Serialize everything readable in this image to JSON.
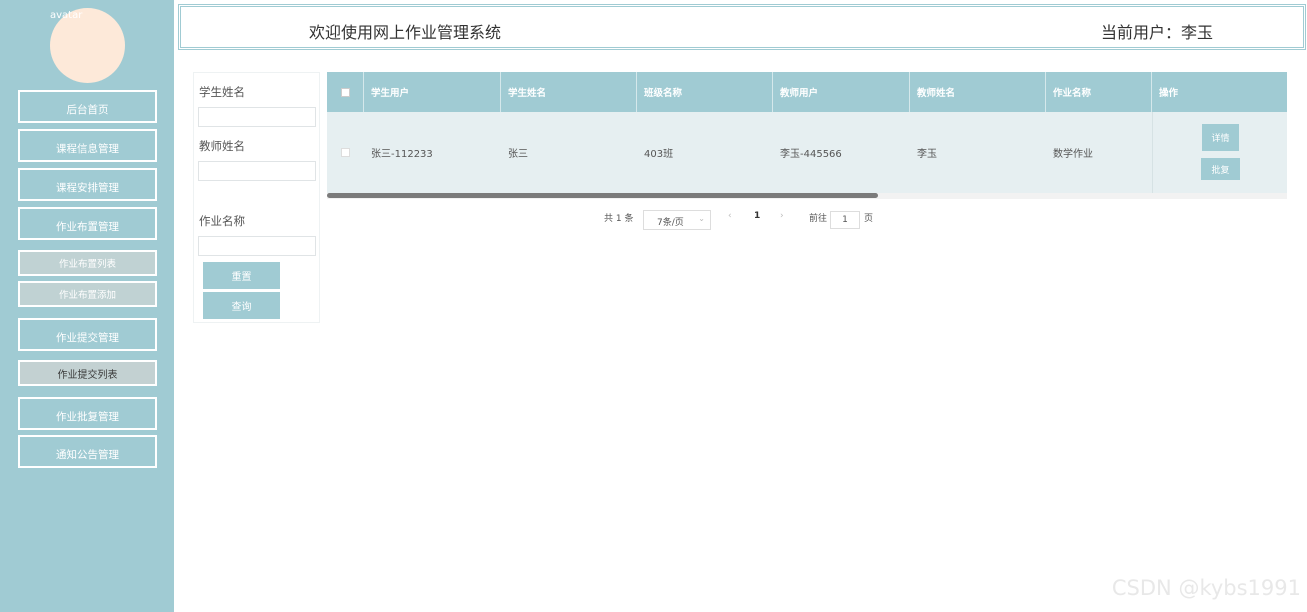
{
  "sidebar": {
    "avatar_alt": "avatar",
    "items": [
      {
        "label": "后台首页"
      },
      {
        "label": "课程信息管理"
      },
      {
        "label": "课程安排管理"
      },
      {
        "label": "作业布置管理"
      },
      {
        "label": "作业布置列表"
      },
      {
        "label": "作业布置添加"
      },
      {
        "label": "作业提交管理"
      },
      {
        "label": "作业提交列表"
      },
      {
        "label": "作业批复管理"
      },
      {
        "label": "通知公告管理"
      }
    ]
  },
  "header": {
    "title": "欢迎使用网上作业管理系统",
    "user": "当前用户：李玉"
  },
  "search": {
    "label_student": "学生姓名",
    "label_teacher": "教师姓名",
    "label_homework": "作业名称",
    "reset": "重置",
    "query": "查询"
  },
  "table": {
    "headers": [
      "学生用户",
      "学生姓名",
      "班级名称",
      "教师用户",
      "教师姓名",
      "作业名称",
      "操作"
    ],
    "rows": [
      {
        "student_user": "张三-112233",
        "student_name": "张三",
        "class": "403班",
        "teacher_user": "李玉-445566",
        "teacher_name": "李玉",
        "homework": "数学作业",
        "detail": "详情",
        "reply": "批复"
      }
    ]
  },
  "pager": {
    "total": "共 1 条",
    "page_size": "7条/页",
    "current": "1",
    "goto": "前往",
    "goto_value": "1",
    "page_unit": "页"
  },
  "watermark": "CSDN @kybs1991",
  "colors": {
    "accent": "#a0cbd3",
    "row_bg": "#e6eff1",
    "avatar": "#fde9d9"
  }
}
